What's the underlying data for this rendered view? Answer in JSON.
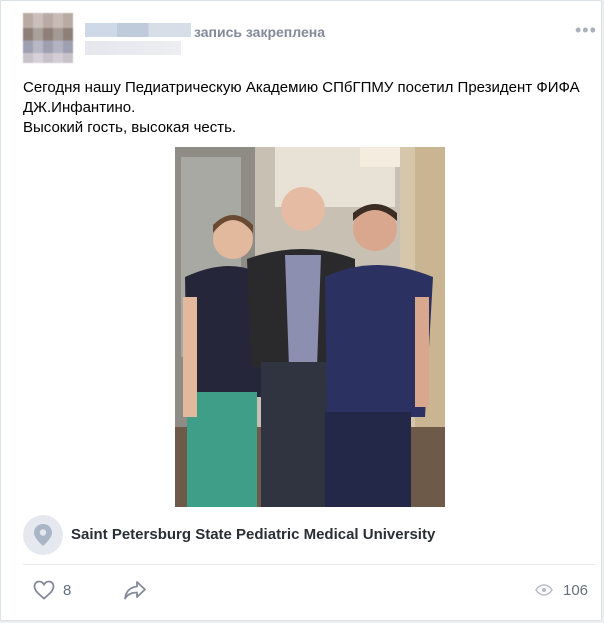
{
  "post": {
    "status": "запись закреплена",
    "text_lines": [
      "Сегодня нашу Педиатрическую Академию СПбГПМУ посетил Президент ФИФА",
      "ДЖ.Инфантино.",
      "Высокий гость, высокая честь."
    ]
  },
  "location": {
    "name": "Saint Petersburg State Pediatric Medical University"
  },
  "footer": {
    "likes": "8",
    "views": "106"
  },
  "icons": {
    "more": "more-dots-icon",
    "location": "location-pin-icon",
    "like": "heart-icon",
    "share": "share-arrow-icon",
    "views": "eye-icon"
  },
  "colors": {
    "icon_gray": "#828a99",
    "text_gray": "#656f7e"
  }
}
